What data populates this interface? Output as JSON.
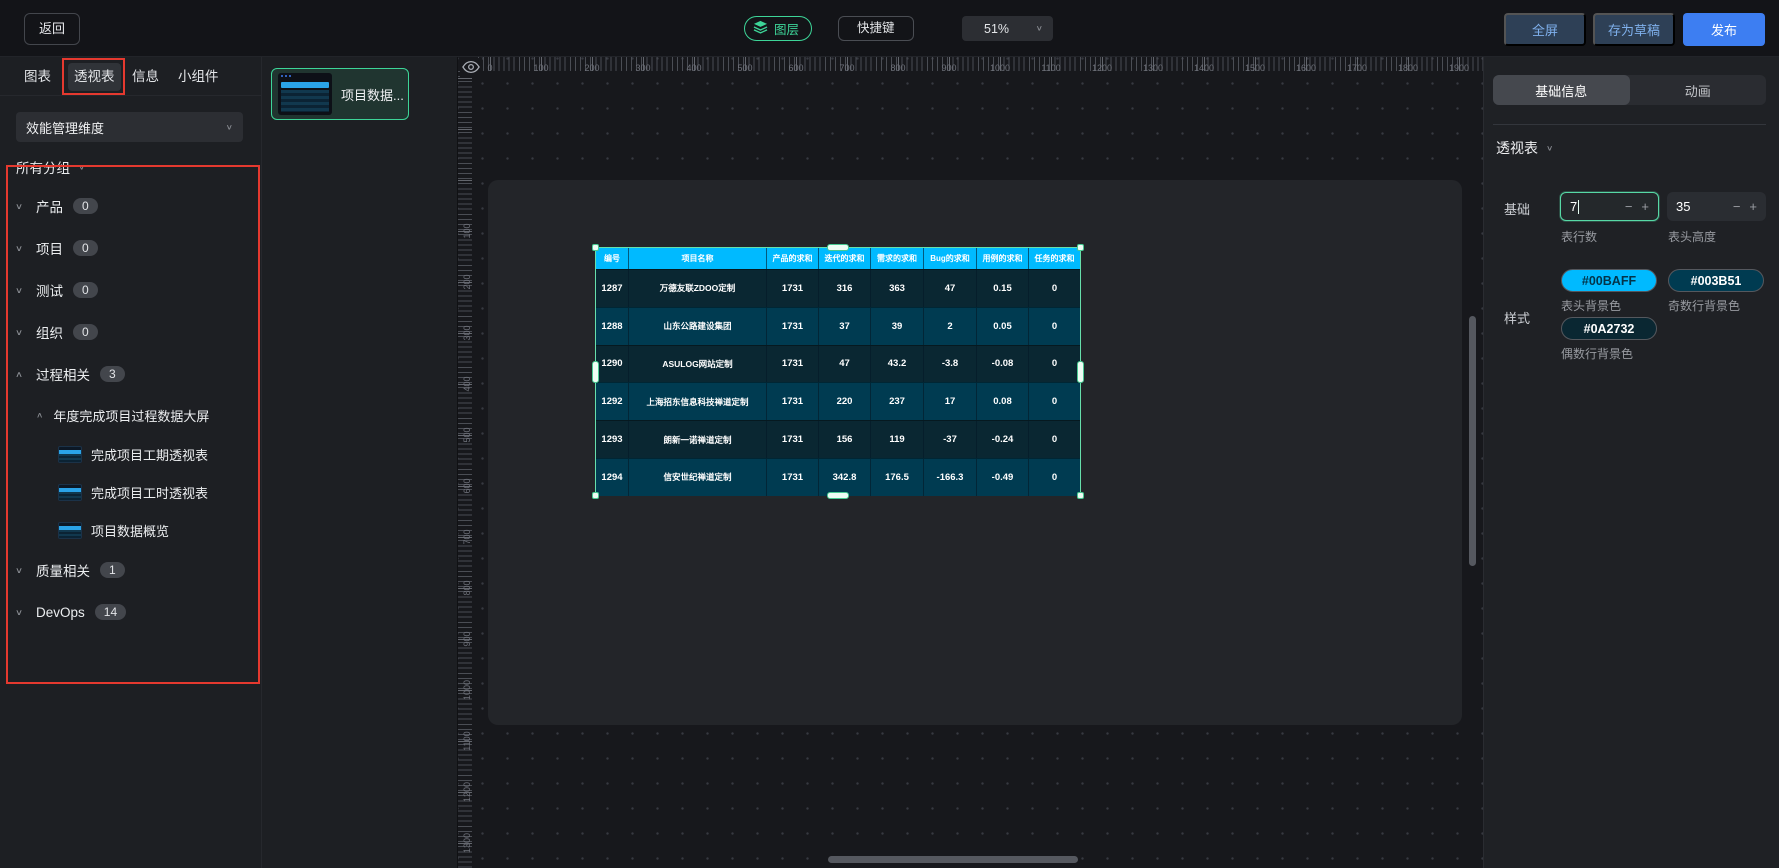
{
  "topbar": {
    "back": "返回",
    "layers": "图层",
    "shortcuts": "快捷键",
    "zoom_value": "51%",
    "fullscreen": "全屏",
    "save_draft": "存为草稿",
    "publish": "发布"
  },
  "left_tabs": [
    {
      "label": "图表",
      "active": false
    },
    {
      "label": "透视表",
      "active": true,
      "annotated": true
    },
    {
      "label": "信息",
      "active": false
    },
    {
      "label": "小组件",
      "active": false
    }
  ],
  "library": {
    "dimension_select": "效能管理维度",
    "group_filter": "所有分组",
    "groups": [
      {
        "label": "产品",
        "count": "0",
        "expanded": false
      },
      {
        "label": "项目",
        "count": "0",
        "expanded": false
      },
      {
        "label": "测试",
        "count": "0",
        "expanded": false
      },
      {
        "label": "组织",
        "count": "0",
        "expanded": false
      },
      {
        "label": "过程相关",
        "count": "3",
        "expanded": true,
        "children": [
          {
            "label": "年度完成项目过程数据大屏",
            "expanded": true,
            "items": [
              "完成项目工期透视表",
              "完成项目工时透视表",
              "项目数据概览"
            ]
          }
        ]
      },
      {
        "label": "质量相关",
        "count": "1",
        "expanded": false
      },
      {
        "label": "DevOps",
        "count": "14",
        "expanded": false
      }
    ]
  },
  "thumbnails": [
    {
      "label": "项目数据...",
      "selected": true
    }
  ],
  "canvas": {
    "h_ruler": {
      "start": 0,
      "end": 1900,
      "step": 100
    },
    "v_ruler": {
      "start": 100,
      "end": 1300,
      "step": 100
    },
    "zoom_factor": 0.51
  },
  "table": {
    "columns": [
      "编号",
      "项目名称",
      "产品的求和",
      "迭代的求和",
      "需求的求和",
      "Bug的求和",
      "用例的求和",
      "任务的求和"
    ],
    "rows": [
      [
        "1287",
        "万德友联ZDOO定制",
        "1731",
        "316",
        "363",
        "47",
        "0.15",
        "0"
      ],
      [
        "1288",
        "山东公路建设集团",
        "1731",
        "37",
        "39",
        "2",
        "0.05",
        "0"
      ],
      [
        "1290",
        "ASULOG网站定制",
        "1731",
        "47",
        "43.2",
        "-3.8",
        "-0.08",
        "0"
      ],
      [
        "1292",
        "上海招东信息科技禅道定制",
        "1731",
        "220",
        "237",
        "17",
        "0.08",
        "0"
      ],
      [
        "1293",
        "朗新一诺禅道定制",
        "1731",
        "156",
        "119",
        "-37",
        "-0.24",
        "0"
      ],
      [
        "1294",
        "信安世纪禅道定制",
        "1731",
        "342.8",
        "176.5",
        "-166.3",
        "-0.49",
        "0"
      ]
    ],
    "header_bg": "#00BAFF",
    "odd_row_bg": "#003B51",
    "even_row_bg": "#0A2732"
  },
  "inspector": {
    "tabs": [
      {
        "label": "基础信息",
        "active": true
      },
      {
        "label": "动画",
        "active": false
      }
    ],
    "component_section": "透视表",
    "basic": {
      "label": "基础",
      "fields": [
        {
          "value": "7",
          "label": "表行数",
          "focused": true
        },
        {
          "value": "35",
          "label": "表头高度",
          "focused": false
        }
      ]
    },
    "style": {
      "label": "样式",
      "fields": [
        {
          "value": "#00BAFF",
          "label": "表头背景色"
        },
        {
          "value": "#003B51",
          "label": "奇数行背景色"
        },
        {
          "value": "#0A2732",
          "label": "偶数行背景色"
        }
      ]
    }
  },
  "icons": {
    "chevron_down": "∨",
    "chevron_up": "∧",
    "minus": "−",
    "plus": "+"
  }
}
